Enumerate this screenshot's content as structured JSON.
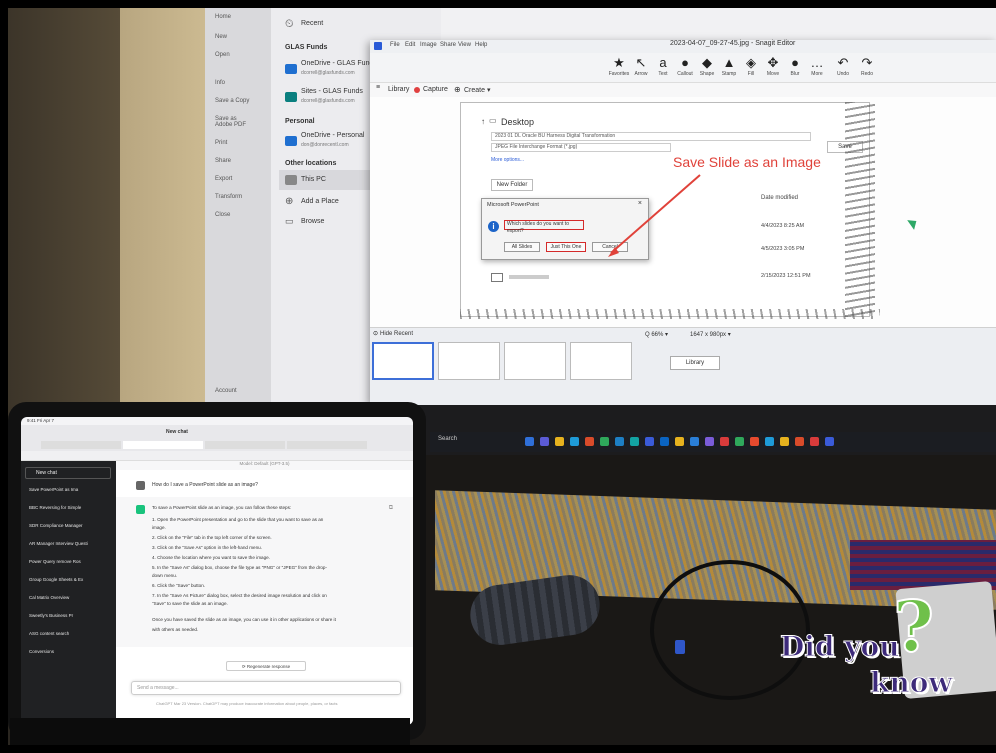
{
  "saveas": {
    "nav": [
      "Home",
      "New",
      "Open",
      "Info",
      "Save a Copy",
      "Save as Adobe PDF",
      "Print",
      "Share",
      "Export",
      "Transform",
      "Close",
      "Account"
    ],
    "places": {
      "recent": "Recent",
      "org": "GLAS Funds",
      "onedrive_org": "OneDrive - GLAS Funds",
      "onedrive_org_email": "dcorrell@glasfunds.com",
      "sites_org": "Sites - GLAS Funds",
      "sites_org_email": "dcorrell@glasfunds.com",
      "personal": "Personal",
      "onedrive_personal": "OneDrive - Personal",
      "onedrive_personal_email": "don@donrecentl.com",
      "other": "Other locations",
      "this_pc": "This PC",
      "add_place": "Add a Place",
      "browse": "Browse"
    },
    "file_fields": [
      "2023 01 DL Oracle BU Harness Digital Transformation",
      "JPEG File Interchange Format (*.jpg)"
    ]
  },
  "snagit": {
    "window_title": "2023-04-07_09-27-45.jpg - Snagit Editor",
    "menus": [
      "File",
      "Edit",
      "Image",
      "Share",
      "View",
      "Help"
    ],
    "tools": [
      {
        "label": "Favorites",
        "icon": "★"
      },
      {
        "label": "Arrow",
        "icon": "↖"
      },
      {
        "label": "Text",
        "icon": "a"
      },
      {
        "label": "Callout",
        "icon": "●"
      },
      {
        "label": "Shape",
        "icon": "◆"
      },
      {
        "label": "Stamp",
        "icon": "▲"
      },
      {
        "label": "Fill",
        "icon": "◈"
      },
      {
        "label": "Move",
        "icon": "✥"
      },
      {
        "label": "Blur",
        "icon": "●"
      },
      {
        "label": "More",
        "icon": "…"
      },
      {
        "label": "Undo",
        "icon": "↶"
      },
      {
        "label": "Redo",
        "icon": "↷"
      }
    ],
    "library_bar": {
      "library": "Library",
      "capture": "Capture",
      "create": "Create ▾"
    },
    "captured": {
      "location": "Desktop",
      "filename": "2023 01 DL Oracle BU Harness Digital Transformation",
      "filetype": "JPEG File Interchange Format (*.jpg)",
      "more_options": "More options...",
      "save_label": "Save",
      "new_folder": "New Folder",
      "date_header": "Date modified",
      "dates": [
        "4/4/2023 8:25 AM",
        "4/5/2023 3:05 PM",
        "2/15/2023 12:51 PM"
      ]
    },
    "dialog": {
      "title": "Microsoft PowerPoint",
      "question": "Which slides do you want to export?",
      "buttons": [
        "All Slides",
        "Just This One",
        "Cancel"
      ]
    },
    "annotation": "Save Slide as an Image",
    "recent_label": "Hide Recent",
    "zoom": "Q  66%  ▾",
    "size": "1647 x 980px  ▾",
    "library_button": "Library"
  },
  "taskbar": {
    "search": "Search",
    "brand": "LG"
  },
  "chat": {
    "status": "9:41 Fri Apr 7",
    "page_title": "New chat",
    "model_label": "Model: Default (GPT-3.5)",
    "sidebar": [
      "New chat",
      "Save PowerPoint as Ima",
      "BBC Reversing for Simple",
      "SDR Compliance Manager",
      "AR Manager Interview Questi",
      "Power Query remove Ros",
      "Group Google Sheets & Ex",
      "Cal Matrix Overview",
      "Sweetly's Business Pr",
      "ASG content search",
      "Conversions"
    ],
    "user_question": "How do I save a PowerPoint slide as an image?",
    "answer_lines": [
      "To save a PowerPoint slide as an image, you can follow these steps:",
      "1.  Open the PowerPoint presentation and go to the slide that you want to save as an",
      "     image.",
      "2.  Click on the \"File\" tab in the top left corner of the screen.",
      "3.  Click on the \"Save As\" option in the left-hand menu.",
      "4.  Choose the location where you want to save the image.",
      "5.  In the \"Save As\" dialog box, choose the file type as \"PNG\" or \"JPEG\" from the drop-",
      "     down menu.",
      "6.  Click the \"Save\" button.",
      "7.  In the \"Save As Picture\" dialog box, select the desired image resolution and click on",
      "     \"Save\" to save the slide as an image.",
      "Once you have saved the slide as an image, you can use it in other applications or share it",
      "with others as needed."
    ],
    "regenerate": "⟳  Regenerate response",
    "send_placeholder": "Send a message...",
    "disclaimer": "ChatGPT Mar 23 Version. ChatGPT may produce inaccurate information about people, places, or facts"
  },
  "badge": {
    "did": "Did you",
    "know": "know",
    "mark": "?"
  },
  "colors": {
    "annotation": "#e0423a",
    "badge_purple": "#3d2a7a",
    "badge_green": "#6fc04a",
    "word_blue": "#1c64c8"
  }
}
